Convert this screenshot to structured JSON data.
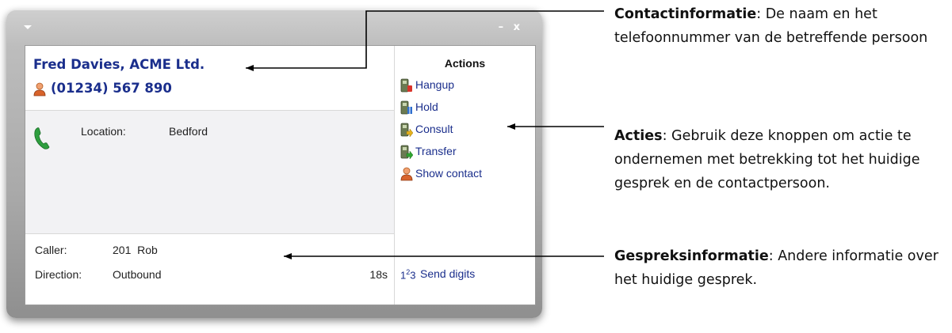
{
  "window": {
    "title_controls": "– x"
  },
  "contact": {
    "name": "Fred Davies, ACME Ltd.",
    "phone": "(01234) 567 890"
  },
  "details": {
    "location_label": "Location:",
    "location_value": "Bedford"
  },
  "call_info": {
    "caller_label": "Caller:",
    "caller_value": "201  Rob",
    "direction_label": "Direction:",
    "direction_value": "Outbound",
    "duration": "18s"
  },
  "actions": {
    "title": "Actions",
    "items": [
      {
        "label": "Hangup",
        "icon": "hangup-icon",
        "accent": "#d9342b"
      },
      {
        "label": "Hold",
        "icon": "hold-icon",
        "accent": "#2f6fcf"
      },
      {
        "label": "Consult",
        "icon": "consult-icon",
        "accent": "#e6b21c"
      },
      {
        "label": "Transfer",
        "icon": "transfer-icon",
        "accent": "#2fa52f"
      },
      {
        "label": "Show contact",
        "icon": "contact-icon",
        "accent": "#d8632b"
      }
    ],
    "send_digits_label": "Send digits"
  },
  "annotations": [
    {
      "term": "Contactinformatie",
      "text": ": De naam en het telefoonnummer van de betreffende persoon"
    },
    {
      "term": "Acties",
      "text": ": Gebruik deze knoppen om actie te ondernemen met betrekking tot het huidige gesprek en de contactpersoon."
    },
    {
      "term": "Gespreksinformatie",
      "text": ": Andere informatie over het huidige gesprek."
    }
  ],
  "colors": {
    "link": "#1a2e8c",
    "details_bg": "#f2f2f4",
    "window_frame": "#a9a9a9"
  }
}
